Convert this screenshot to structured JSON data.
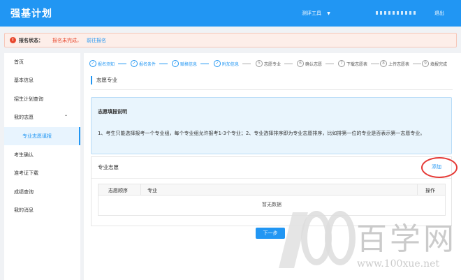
{
  "app": {
    "title": "强基计划"
  },
  "header": {
    "tools_label": "测评工具",
    "logout_label": "退出"
  },
  "notice": {
    "label": "报名状态：",
    "status": "报名未完成，",
    "link": "前往报名"
  },
  "sidebar": {
    "items": [
      {
        "label": "首页"
      },
      {
        "label": "基本信息"
      },
      {
        "label": "招生计划查询"
      },
      {
        "label": "我的志愿"
      },
      {
        "label": "专业志愿填报"
      },
      {
        "label": "考生确认"
      },
      {
        "label": "准考证下载"
      },
      {
        "label": "成绩查询"
      },
      {
        "label": "我的消息"
      }
    ]
  },
  "steps": [
    {
      "label": "报名须知",
      "done": true
    },
    {
      "label": "报名条件",
      "done": true
    },
    {
      "label": "赋格信息",
      "done": true
    },
    {
      "label": "附加信息",
      "done": true
    },
    {
      "num": "5",
      "label": "志愿专业",
      "done": false
    },
    {
      "num": "6",
      "label": "确认志愿",
      "done": false
    },
    {
      "num": "7",
      "label": "下载志愿表",
      "done": false
    },
    {
      "num": "8",
      "label": "上传志愿表",
      "done": false
    },
    {
      "num": "9",
      "label": "填报完成",
      "done": false
    }
  ],
  "main": {
    "section_title": "志愿专业",
    "info_title": "志愿填报说明",
    "info_text": "1、考生只能选择报考一个专业组，每个专业组允许报考1-3个专业；2、专业选择排序即为专业志愿排序，比如排第一位的专业是否表示第一志愿专业。",
    "panel_title": "专业志愿",
    "add_label": "添加",
    "table": {
      "headers": [
        "志愿顺序",
        "专业",
        "操作"
      ],
      "empty_text": "暂无数据"
    },
    "next_label": "下一步"
  },
  "watermark": {
    "digits": "100",
    "cn": "百学网",
    "url": "www.100xue.net"
  },
  "colors": {
    "primary": "#2196f3",
    "danger": "#e8462c",
    "highlight": "#e53935"
  }
}
